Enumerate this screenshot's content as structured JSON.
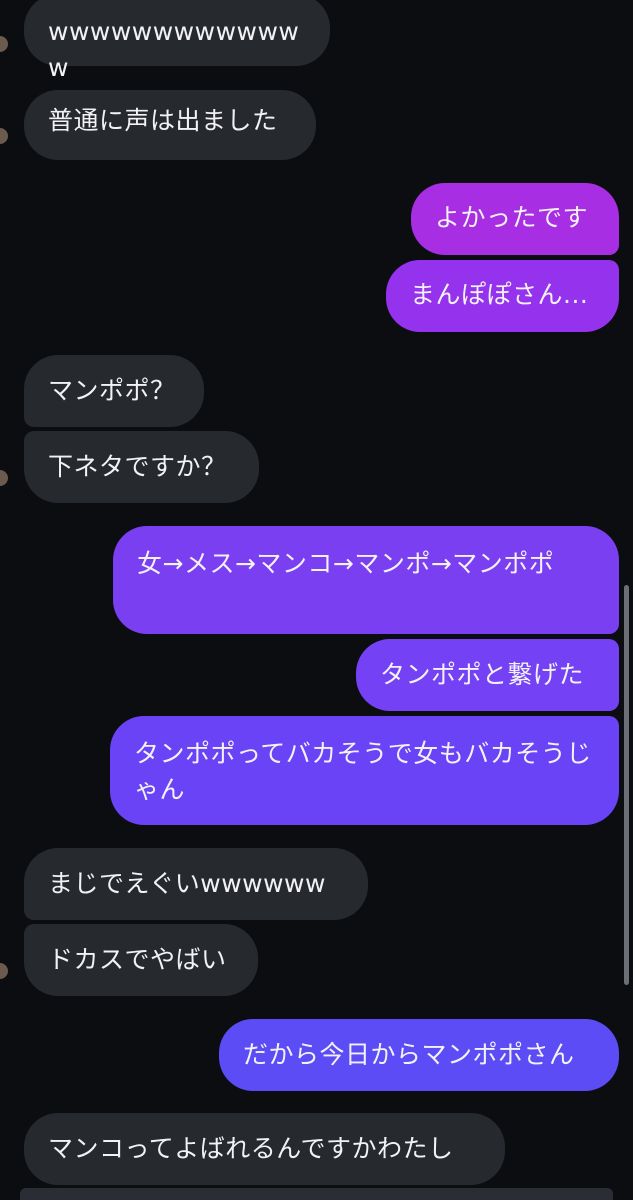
{
  "colors": {
    "background": "#0b0d10",
    "incoming_bubble": "#26292e",
    "outgoing_gradient": [
      "#a72ee3",
      "#7b3ff2",
      "#6a43f6",
      "#5c4cf5"
    ]
  },
  "messages": [
    {
      "side": "in",
      "text": "wwwwwwwwwwwww"
    },
    {
      "side": "in",
      "text": "普通に声は出ました"
    },
    {
      "side": "out",
      "text": "よかったです"
    },
    {
      "side": "out",
      "text": "まんぽぽさん..."
    },
    {
      "side": "in",
      "text": "マンポポ？"
    },
    {
      "side": "in",
      "text": "下ネタですか？"
    },
    {
      "side": "out",
      "text": "女→メス→マンコ→マンポ→マンポポ"
    },
    {
      "side": "out",
      "text": "タンポポと繋げた"
    },
    {
      "side": "out",
      "text": "タンポポってバカそうで女もバカそうじゃん"
    },
    {
      "side": "in",
      "text": "まじでえぐいwwwwww"
    },
    {
      "side": "in",
      "text": "ドカスでやばい"
    },
    {
      "side": "out",
      "text": "だから今日からマンポポさん"
    },
    {
      "side": "in",
      "text": "マンコってよばれるんですかわたし"
    }
  ]
}
